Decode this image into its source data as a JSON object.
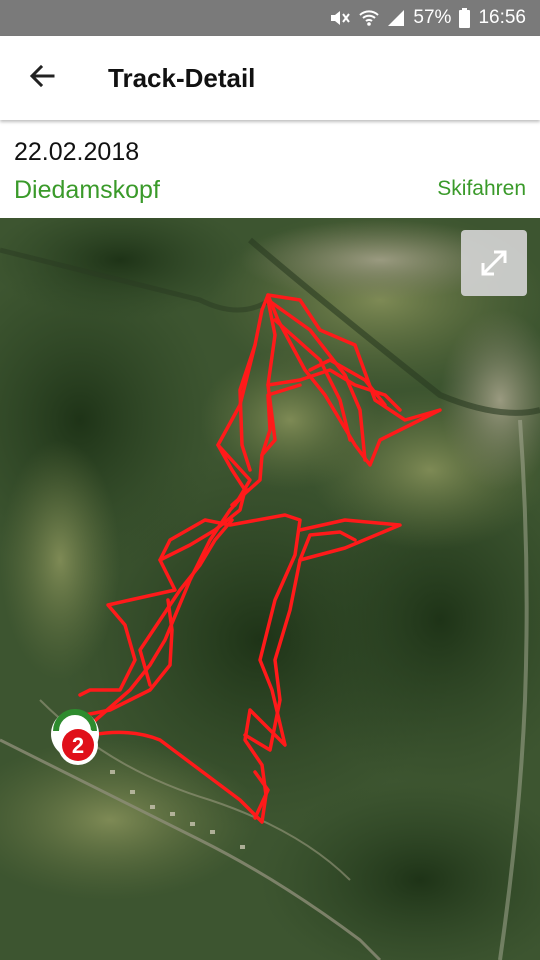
{
  "status_bar": {
    "battery_percent": "57%",
    "time": "16:56",
    "icons": [
      "mute-icon",
      "wifi-icon",
      "signal-icon",
      "battery-icon"
    ]
  },
  "toolbar": {
    "title": "Track-Detail",
    "back_icon": "arrow-left-icon"
  },
  "track": {
    "date": "22.02.2018",
    "location": "Diedamskopf",
    "activity": "Skifahren"
  },
  "map": {
    "marker_label": "2",
    "expand_icon": "expand-diagonal-icon",
    "track_color": "#ff1a1a"
  },
  "colors": {
    "accent_green": "#3a9a2a",
    "status_bar": "#7a7a7a"
  }
}
